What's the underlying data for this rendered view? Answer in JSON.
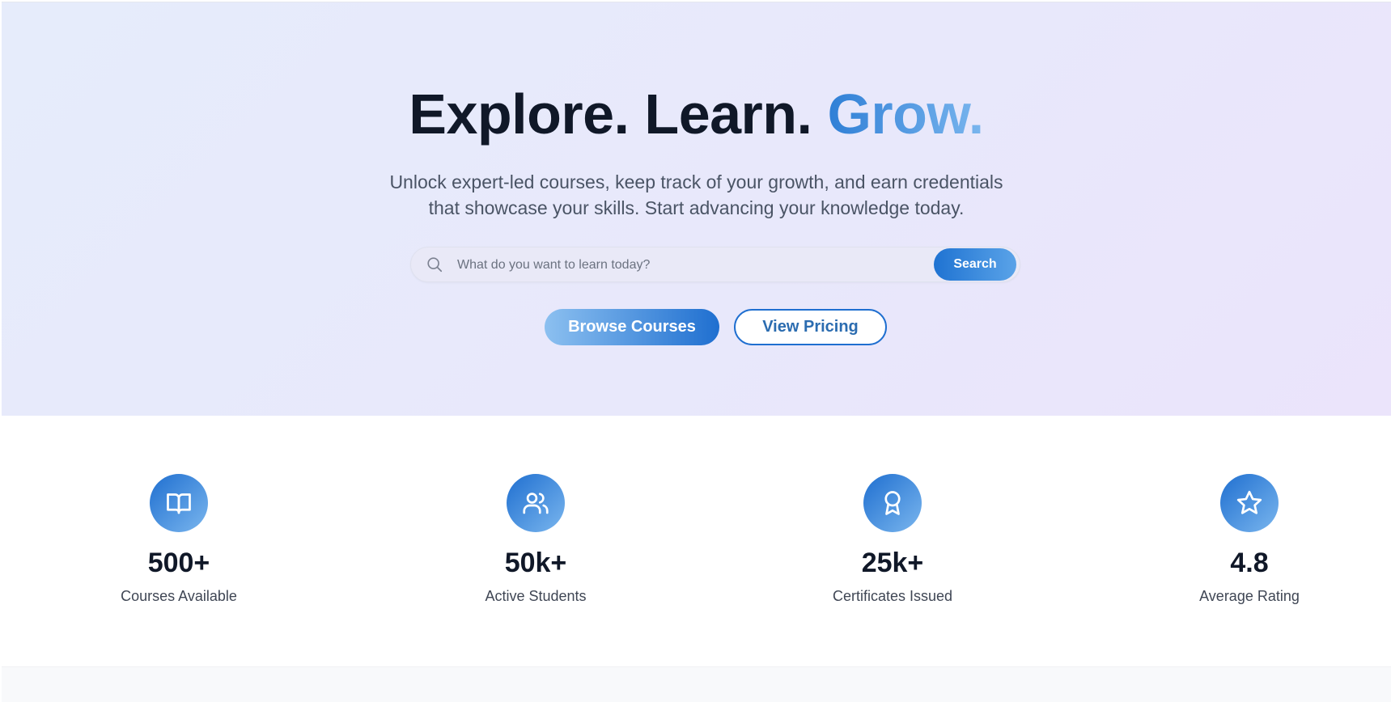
{
  "hero": {
    "title_part1": "Explore. Learn.",
    "title_accent": "Grow.",
    "subtitle_line1": "Unlock expert-led courses, keep track of your growth, and earn credentials",
    "subtitle_line2": "that showcase your skills. Start advancing your knowledge today."
  },
  "search": {
    "placeholder": "What do you want to learn today?",
    "value": "",
    "button_label": "Search",
    "icon": "search-icon"
  },
  "cta": {
    "primary_label": "Browse Courses",
    "secondary_label": "View Pricing"
  },
  "stats": [
    {
      "icon": "book-open-icon",
      "value": "500+",
      "label": "Courses Available"
    },
    {
      "icon": "users-icon",
      "value": "50k+",
      "label": "Active Students"
    },
    {
      "icon": "award-icon",
      "value": "25k+",
      "label": "Certificates Issued"
    },
    {
      "icon": "star-icon",
      "value": "4.8",
      "label": "Average Rating"
    }
  ],
  "colors": {
    "brand_blue": "#1f6fd0",
    "brand_light_blue": "#7ab6ee",
    "heading": "#101828",
    "hero_bg": "#e7e9fb"
  }
}
